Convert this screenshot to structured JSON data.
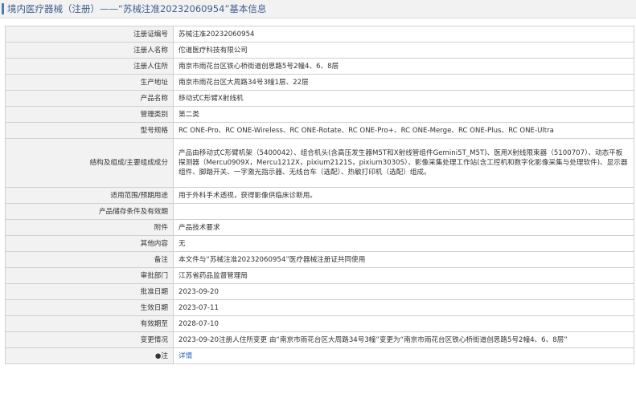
{
  "page": {
    "title": "境内医疗器械（注册）——“苏械注准20232060954”基本信息"
  },
  "rows": [
    {
      "label": "注册证编号",
      "value": "苏械注准20232060954"
    },
    {
      "label": "注册人名称",
      "value": "佗道医疗科技有限公司"
    },
    {
      "label": "注册人住所",
      "value": "南京市雨花台区铁心桥街道创思路5号2幢4、6、8层"
    },
    {
      "label": "生产地址",
      "value": "南京市雨花台区大周路34号3幢1层、22层"
    },
    {
      "label": "产品名称",
      "value": "移动式C形臂X射线机"
    },
    {
      "label": "管理类别",
      "value": "第二类"
    },
    {
      "label": "型号规格",
      "value": "RC ONE-Pro、RC ONE-Wireless、RC ONE-Rotate、RC ONE-Pro+、RC ONE-Merge、RC ONE-Plus、RC ONE-Ultra"
    },
    {
      "label": "结构及组成/主要组成成分",
      "value": "产品由移动式C形臂机架（5400042）、组合机头(含高压发生器M5T和X射线管组件Gemini5T_M5T)、医用X射线限束器（5100707）、动态平板探测器（Mercu0909X，Mercu1212X，pixium2121S，pixium3030S）、影像采集处理工作站(含工控机和数字化影像采集与处理软件)、显示器组件、脚踏开关、一字激光指示器、无线台车（选配）、热敏打印机（选配）组成。"
    },
    {
      "label": "适用范围/预期用途",
      "value": "用于外科手术透视，获得影像供临床诊断用。"
    },
    {
      "label": "产品储存条件及有效期",
      "value": ""
    },
    {
      "label": "附件",
      "value": "产品技术要求"
    },
    {
      "label": "其他内容",
      "value": "无"
    },
    {
      "label": "备注",
      "value": "本文件与“苏械注准20232060954”医疗器械注册证共同使用"
    },
    {
      "label": "审批部门",
      "value": "江苏省药品监督管理局"
    },
    {
      "label": "批准日期",
      "value": "2023-09-20"
    },
    {
      "label": "生效日期",
      "value": "2023-07-11"
    },
    {
      "label": "有效期至",
      "value": "2028-07-10"
    },
    {
      "label": "变更情况",
      "value": "2023-09-20注册人住所变更 由“南京市雨花台区大周路34号3幢”变更为“南京市雨花台区铁心桥街道创思路5号2幢4、6、8层”"
    },
    {
      "label": "●注",
      "value": "详情"
    }
  ]
}
